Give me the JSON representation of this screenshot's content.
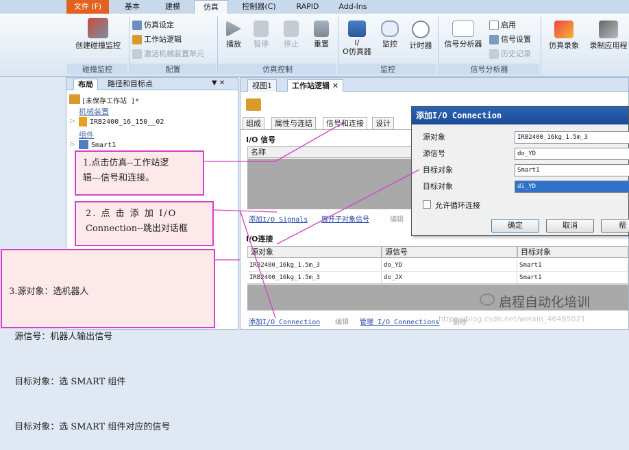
{
  "ribbon_tabs": [
    "文件 (F)",
    "基本",
    "建模",
    "仿真",
    "控制器(C)",
    "RAPID",
    "Add-Ins"
  ],
  "ribbon": {
    "collision": {
      "btn": "创建碰撞监控",
      "group": "碰撞监控"
    },
    "config": {
      "items": [
        "仿真设定",
        "工作站逻辑",
        "激活机械装置单元"
      ],
      "group": "配置"
    },
    "control": {
      "items": [
        "播放",
        "暂停",
        "停止",
        "重置"
      ],
      "group": "仿真控制"
    },
    "monitor": {
      "items": [
        "I/\nO仿真器",
        "监控",
        "计时器"
      ],
      "group": "监控"
    },
    "signal": {
      "btn": "信号分析器",
      "small": [
        "启用",
        "信号设置",
        "历史记录"
      ],
      "group": "信号分析器"
    },
    "record": {
      "items": [
        "仿真录象",
        "录制应用程"
      ]
    }
  },
  "left_panel": {
    "tabs": [
      "布局",
      "路径和目标点"
    ],
    "pin": "▼ ✕",
    "station": "[未保存工作站 ]*",
    "mechanisms_label": "机械装置",
    "robot": "IRB2400_16_150__02",
    "components_label": "组件",
    "component": "Smart1"
  },
  "doc_tabs": [
    "视图1",
    "工作站逻辑"
  ],
  "sub_tabs": [
    "组成",
    "属性与连结",
    "信号和连接",
    "设计"
  ],
  "io_signals": {
    "title": "I/O 信号",
    "header": "名称",
    "actions": [
      "添加I/O Signals",
      "展开子对象信号",
      "编辑"
    ]
  },
  "io_connections": {
    "title": "I/O连接",
    "headers": [
      "源对象",
      "源信号",
      "目标对象"
    ],
    "rows": [
      [
        "IRB2400_16kg_1.5m_3",
        "do_YD",
        "Smart1"
      ],
      [
        "IRB2400_16kg_1.5m_3",
        "do_JX",
        "Smart1"
      ]
    ],
    "actions": [
      "添加I/O Connection",
      "编辑",
      "管理 I/O Connections",
      "删除"
    ]
  },
  "dialog": {
    "title": "添加I/O Connection",
    "labels": [
      "源对象",
      "源信号",
      "目标对象",
      "目标对象"
    ],
    "values": [
      "IRB2400_16kg_1.5m_3",
      "do_YD",
      "Smart1",
      "di_YD"
    ],
    "checkbox": "允许循环连接",
    "ok": "确定",
    "cancel": "取消",
    "help": "帮"
  },
  "callouts": {
    "c1": [
      "1.点击仿真--工作站逻",
      "辑---信号和连接。"
    ],
    "c2": [
      "2. 点 击 添 加  I/O",
      "Connection--跳出对话框"
    ],
    "c3": [
      "3.源对象：选机器人",
      "  源信号：机器人输出信号",
      "  目标对象：选 SMART 组件",
      "  目标对象：选 SMART 组件对应的信号"
    ]
  },
  "watermark": {
    "brand": "启程自动化培训",
    "url": "https://blog.csdn.net/weixin_46485021"
  },
  "colors": {
    "file_tab": "#e0621e",
    "callout_border": "#d640c8",
    "callout_bg": "#fde9e9",
    "dialog_title": "#1b4b95"
  }
}
